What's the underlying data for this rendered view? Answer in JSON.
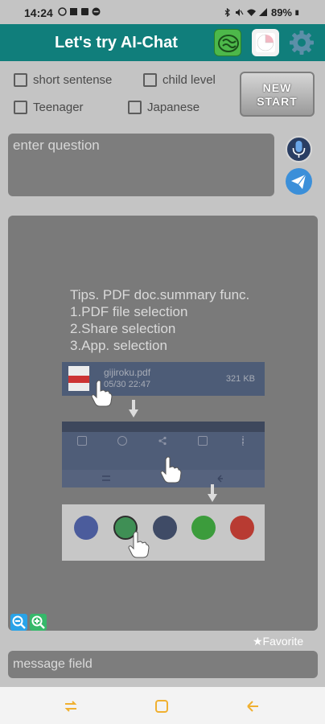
{
  "status_bar": {
    "time": "14:24",
    "left_icons": [
      "data-saver-icon",
      "image-icon",
      "gallery-icon",
      "do-not-disturb-icon"
    ],
    "right_icons": [
      "bluetooth-icon",
      "mute-icon",
      "wifi-icon",
      "signal-icon"
    ],
    "battery": "89%"
  },
  "app_bar": {
    "title": "Let's try AI-Chat",
    "buttons": [
      "hearing-mode-icon",
      "chart-icon",
      "gear-icon"
    ]
  },
  "options": {
    "short_sentence": "short sentense",
    "child_level": "child level",
    "teenager": "Teenager",
    "japanese": "Japanese",
    "new_start_line1": "NEW",
    "new_start_line2": "START"
  },
  "question": {
    "placeholder": "enter question"
  },
  "tips": {
    "lines": [
      "Tips. PDF doc.summary func.",
      "1.PDF file selection",
      "2.Share selection",
      "3.App. selection"
    ],
    "file": {
      "name": "gijiroku.pdf",
      "date": "05/30 22:47",
      "size": "321 KB"
    }
  },
  "favorite": "★Favorite",
  "message": {
    "placeholder": "message field"
  },
  "colors": {
    "app_bar": "#107e7b",
    "background": "#c4c4c4",
    "panel": "#7a7a7a",
    "nav_icons": "#f0b030"
  }
}
